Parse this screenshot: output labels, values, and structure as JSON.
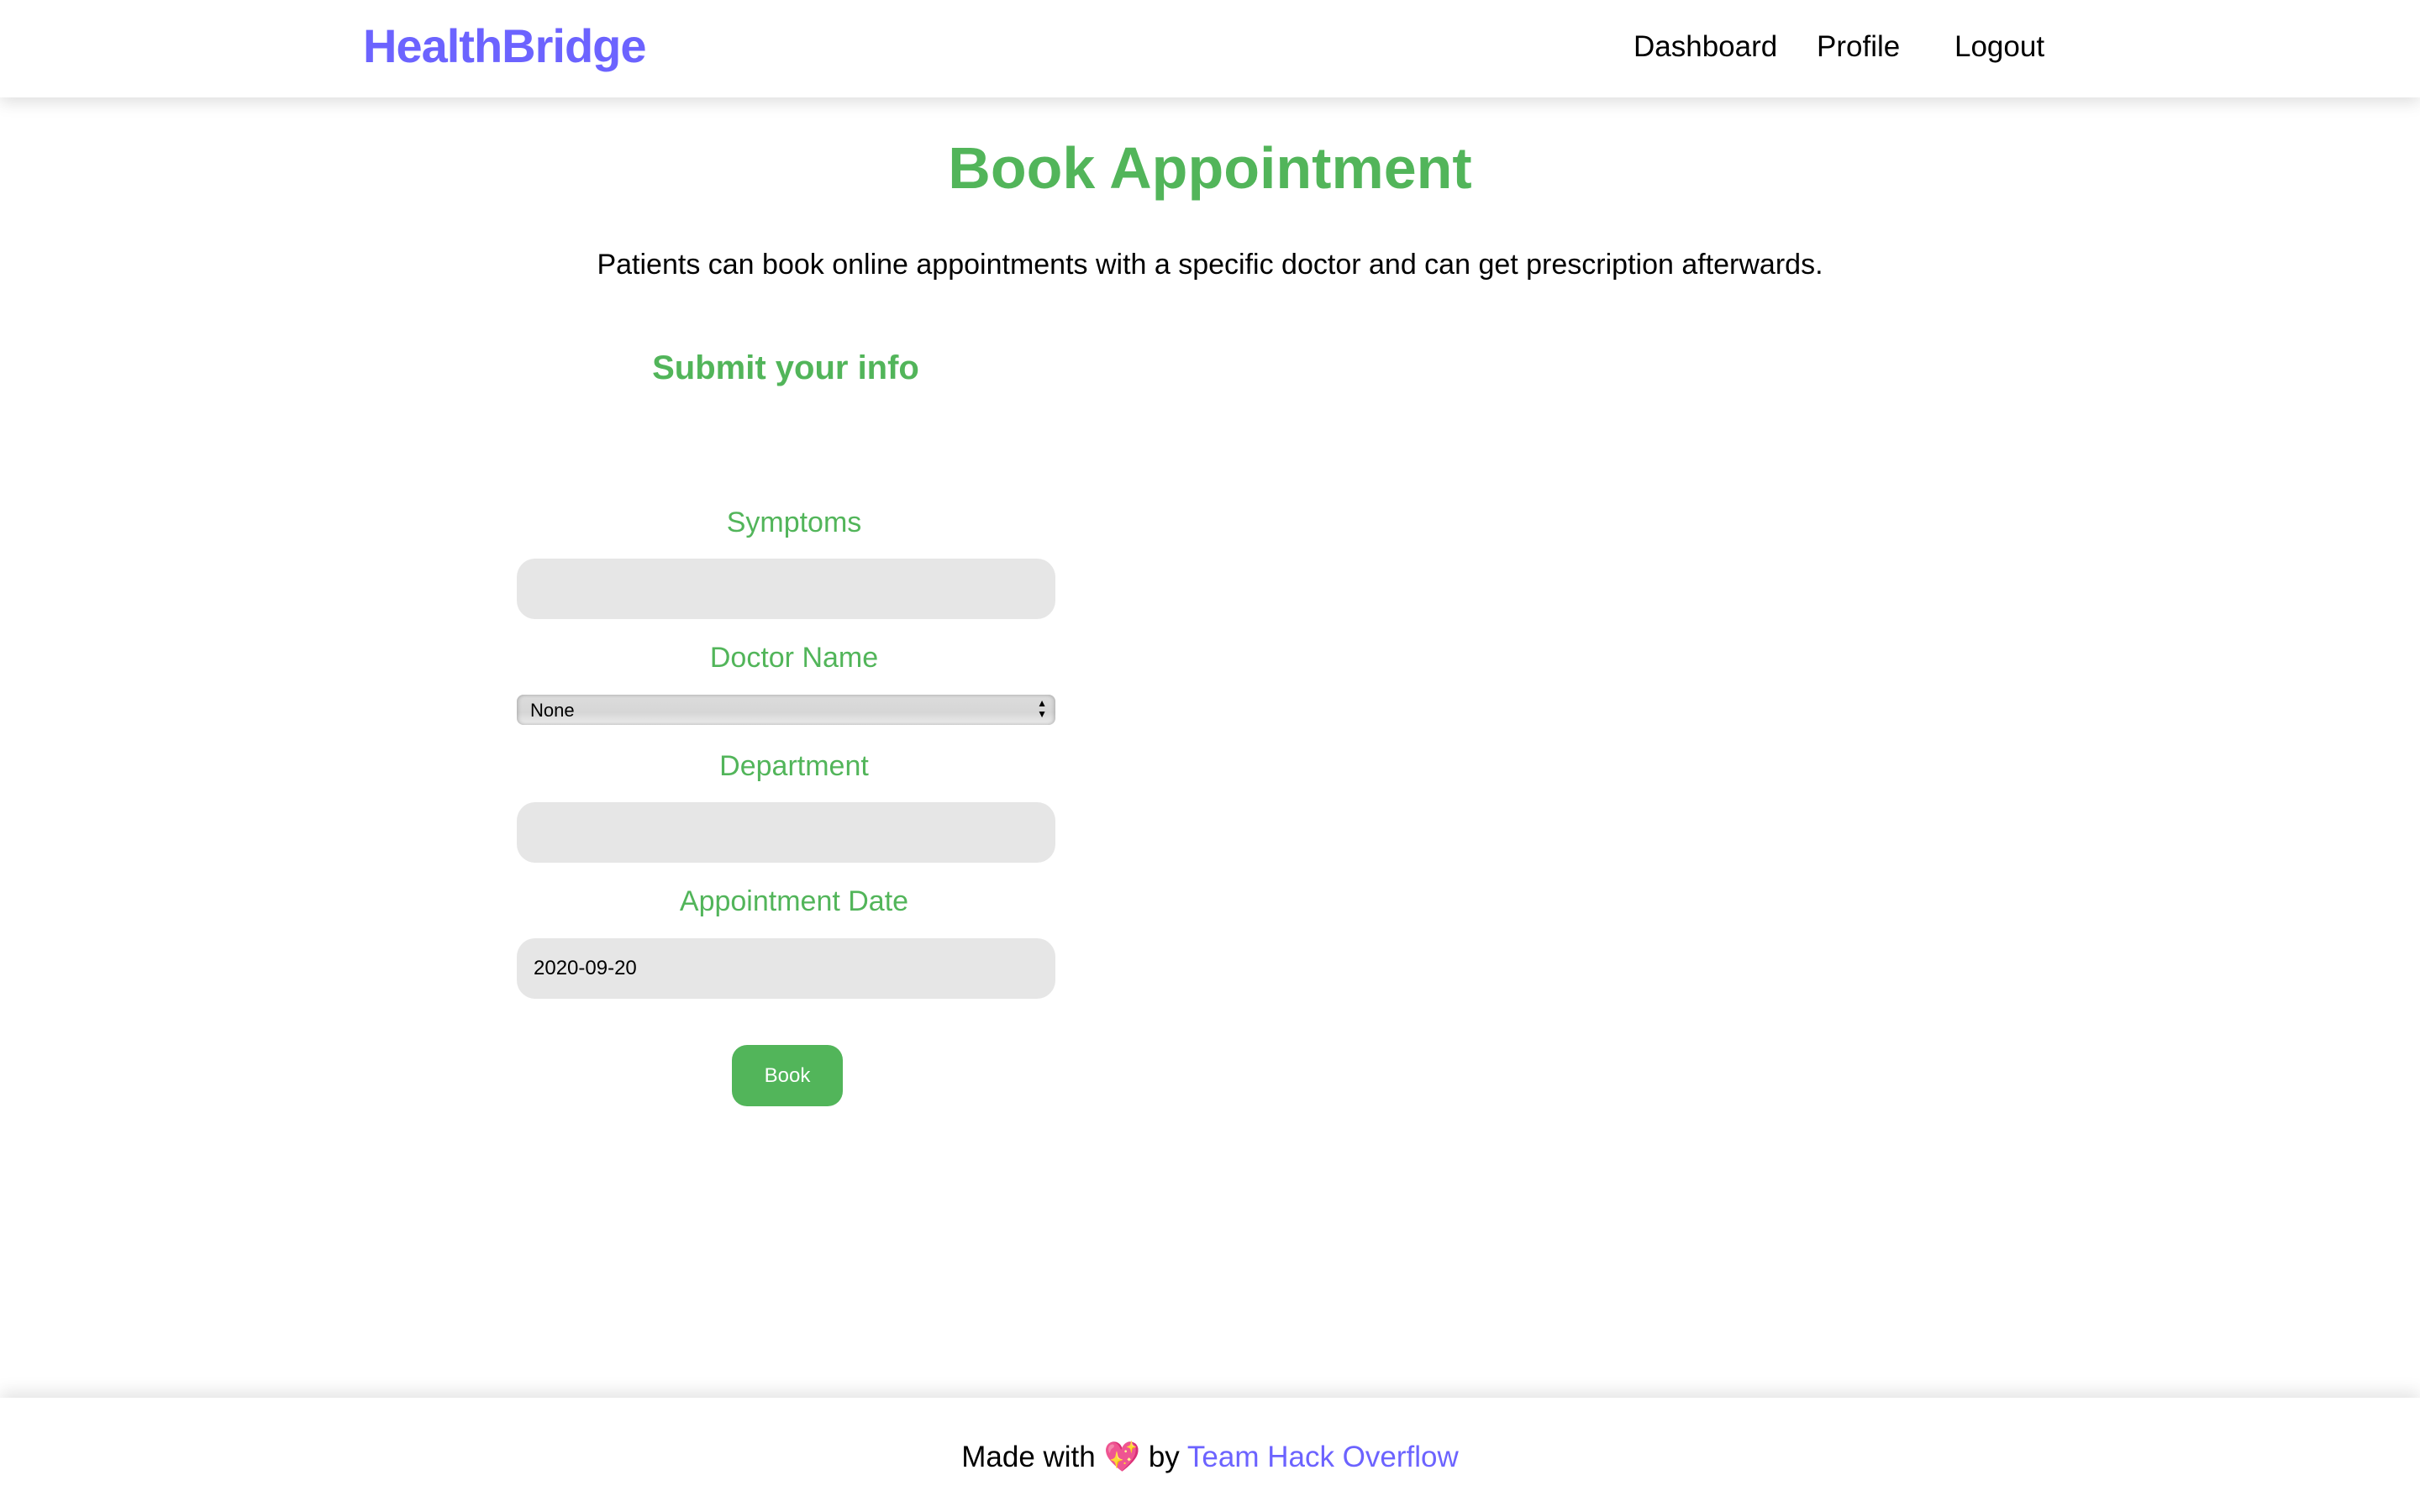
{
  "navbar": {
    "logo": "HealthBridge",
    "links": [
      "Dashboard",
      "Profile",
      "Logout"
    ]
  },
  "page": {
    "title": "Book Appointment",
    "description": "Patients can book online appointments with a specific doctor and can get prescription afterwards.",
    "form_title": "Submit your info"
  },
  "form": {
    "symptoms_label": "Symptoms",
    "symptoms_value": "",
    "doctor_label": "Doctor Name",
    "doctor_selected": "None",
    "department_label": "Department",
    "department_value": "",
    "date_label": "Appointment Date",
    "date_value": "2020-09-20",
    "submit_label": "Book"
  },
  "footer": {
    "prefix": "Made with",
    "emoji": "💖",
    "by": "by",
    "team": "Team Hack Overflow"
  },
  "colors": {
    "brand": "#6c63ff",
    "accent": "#52b55a",
    "input_bg": "#e6e6e6"
  }
}
